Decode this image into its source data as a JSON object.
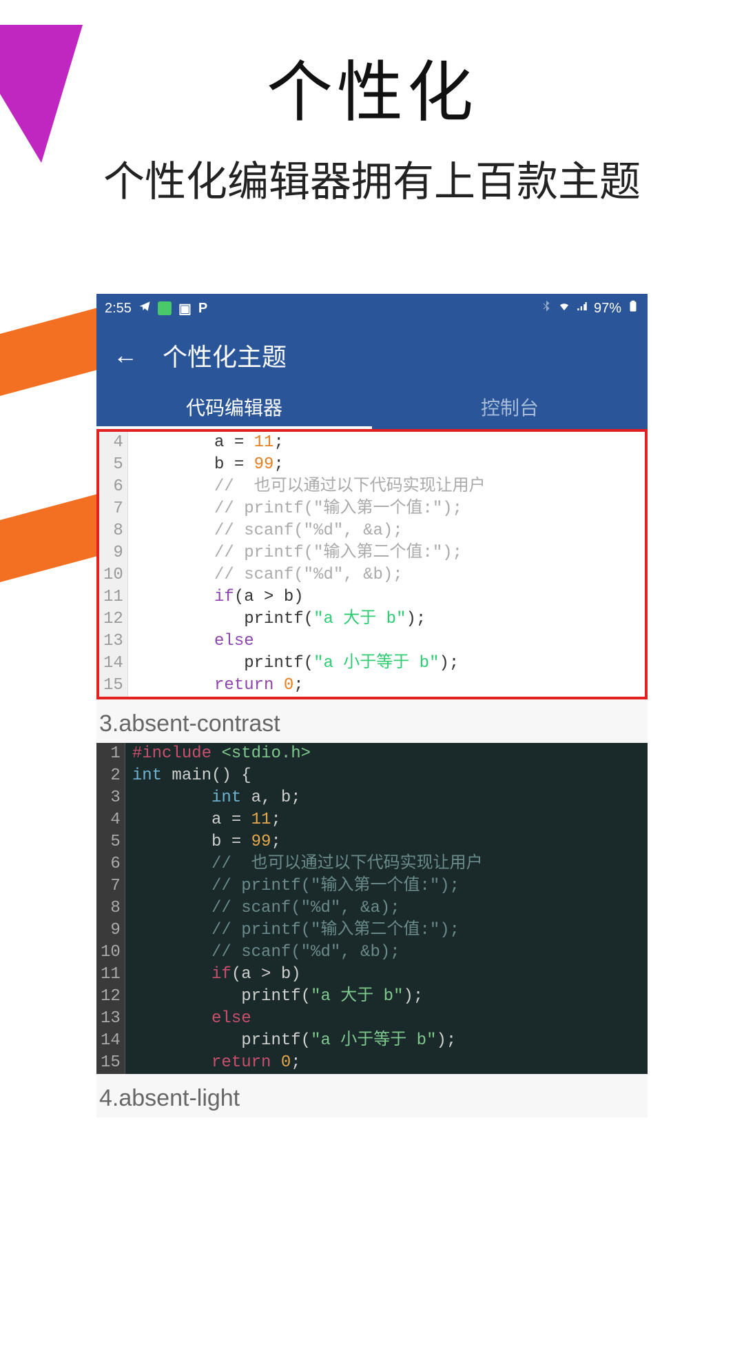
{
  "hero": {
    "title": "个性化",
    "subtitle": "个性化编辑器拥有上百款主题"
  },
  "statusbar": {
    "time": "2:55",
    "battery": "97%"
  },
  "appbar": {
    "title": "个性化主题"
  },
  "tabs": {
    "active": "代码编辑器",
    "inactive": "控制台"
  },
  "themes": {
    "label3": "3.absent-contrast",
    "label4": "4.absent-light"
  },
  "code_light": {
    "gutter": [
      "4",
      "5",
      "6",
      "7",
      "8",
      "9",
      "10",
      "11",
      "12",
      "13",
      "14",
      "15"
    ],
    "lines": [
      [
        {
          "c": "plain",
          "t": "        "
        },
        {
          "c": "plain",
          "t": "a = "
        },
        {
          "c": "num",
          "t": "11"
        },
        {
          "c": "plain",
          "t": ";"
        }
      ],
      [
        {
          "c": "plain",
          "t": "        b = "
        },
        {
          "c": "num",
          "t": "99"
        },
        {
          "c": "plain",
          "t": ";"
        }
      ],
      [
        {
          "c": "cm",
          "t": "        //  也可以通过以下代码实现让用户"
        }
      ],
      [
        {
          "c": "cm",
          "t": "        // printf(\"输入第一个值:\");"
        }
      ],
      [
        {
          "c": "cm",
          "t": "        // scanf(\"%d\", &a);"
        }
      ],
      [
        {
          "c": "cm",
          "t": "        // printf(\"输入第二个值:\");"
        }
      ],
      [
        {
          "c": "cm",
          "t": "        // scanf(\"%d\", &b);"
        }
      ],
      [
        {
          "c": "plain",
          "t": "        "
        },
        {
          "c": "kw",
          "t": "if"
        },
        {
          "c": "plain",
          "t": "(a > b)"
        }
      ],
      [
        {
          "c": "plain",
          "t": "           printf("
        },
        {
          "c": "str",
          "t": "\"a 大于 b\""
        },
        {
          "c": "plain",
          "t": ");"
        }
      ],
      [
        {
          "c": "plain",
          "t": "        "
        },
        {
          "c": "kw",
          "t": "else"
        }
      ],
      [
        {
          "c": "plain",
          "t": "           printf("
        },
        {
          "c": "str",
          "t": "\"a 小于等于 b\""
        },
        {
          "c": "plain",
          "t": ");"
        }
      ],
      [
        {
          "c": "plain",
          "t": "        "
        },
        {
          "c": "kw",
          "t": "return"
        },
        {
          "c": "plain",
          "t": " "
        },
        {
          "c": "num",
          "t": "0"
        },
        {
          "c": "plain",
          "t": ";"
        }
      ]
    ]
  },
  "code_dark": {
    "gutter": [
      "1",
      "2",
      "3",
      "4",
      "5",
      "6",
      "7",
      "8",
      "9",
      "10",
      "11",
      "12",
      "13",
      "14",
      "15"
    ],
    "lines": [
      [
        {
          "c": "pp",
          "t": "#include "
        },
        {
          "c": "inc",
          "t": "<stdio.h>"
        }
      ],
      [
        {
          "c": "ty",
          "t": "int"
        },
        {
          "c": "plain",
          "t": " main() {"
        }
      ],
      [
        {
          "c": "plain",
          "t": "        "
        },
        {
          "c": "ty",
          "t": "int"
        },
        {
          "c": "plain",
          "t": " a, b;"
        }
      ],
      [
        {
          "c": "plain",
          "t": "        a = "
        },
        {
          "c": "num",
          "t": "11"
        },
        {
          "c": "plain",
          "t": ";"
        }
      ],
      [
        {
          "c": "plain",
          "t": "        b = "
        },
        {
          "c": "num",
          "t": "99"
        },
        {
          "c": "plain",
          "t": ";"
        }
      ],
      [
        {
          "c": "cm",
          "t": "        //  也可以通过以下代码实现让用户"
        }
      ],
      [
        {
          "c": "cm",
          "t": "        // printf(\"输入第一个值:\");"
        }
      ],
      [
        {
          "c": "cm",
          "t": "        // scanf(\"%d\", &a);"
        }
      ],
      [
        {
          "c": "cm",
          "t": "        // printf(\"输入第二个值:\");"
        }
      ],
      [
        {
          "c": "cm",
          "t": "        // scanf(\"%d\", &b);"
        }
      ],
      [
        {
          "c": "plain",
          "t": "        "
        },
        {
          "c": "kw",
          "t": "if"
        },
        {
          "c": "plain",
          "t": "(a > b)"
        }
      ],
      [
        {
          "c": "plain",
          "t": "           printf("
        },
        {
          "c": "str",
          "t": "\"a 大于 b\""
        },
        {
          "c": "plain",
          "t": ");"
        }
      ],
      [
        {
          "c": "plain",
          "t": "        "
        },
        {
          "c": "kw",
          "t": "else"
        }
      ],
      [
        {
          "c": "plain",
          "t": "           printf("
        },
        {
          "c": "str",
          "t": "\"a 小于等于 b\""
        },
        {
          "c": "plain",
          "t": ");"
        }
      ],
      [
        {
          "c": "plain",
          "t": "        "
        },
        {
          "c": "kw",
          "t": "return"
        },
        {
          "c": "plain",
          "t": " "
        },
        {
          "c": "num",
          "t": "0"
        },
        {
          "c": "plain",
          "t": ";"
        }
      ]
    ]
  }
}
